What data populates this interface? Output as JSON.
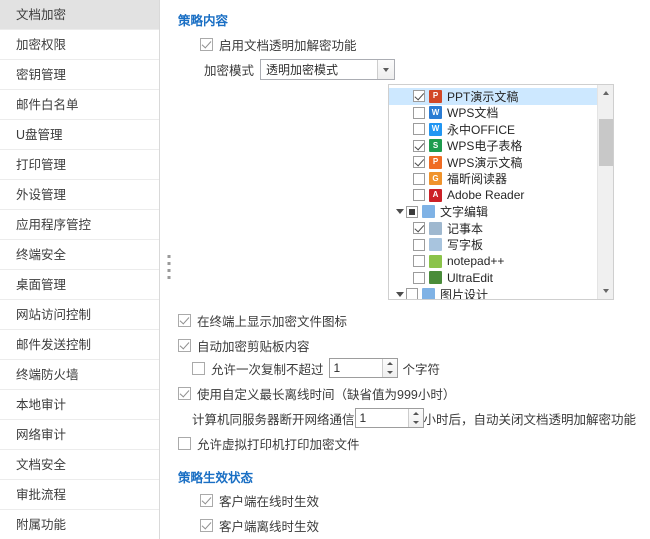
{
  "sidebar": {
    "items": [
      {
        "label": "文档加密",
        "active": true
      },
      {
        "label": "加密权限",
        "active": false
      },
      {
        "label": "密钥管理",
        "active": false
      },
      {
        "label": "邮件白名单",
        "active": false
      },
      {
        "label": "U盘管理",
        "active": false
      },
      {
        "label": "打印管理",
        "active": false
      },
      {
        "label": "外设管理",
        "active": false
      },
      {
        "label": "应用程序管控",
        "active": false
      },
      {
        "label": "终端安全",
        "active": false
      },
      {
        "label": "桌面管理",
        "active": false
      },
      {
        "label": "网站访问控制",
        "active": false
      },
      {
        "label": "邮件发送控制",
        "active": false
      },
      {
        "label": "终端防火墙",
        "active": false
      },
      {
        "label": "本地审计",
        "active": false
      },
      {
        "label": "网络审计",
        "active": false
      },
      {
        "label": "文档安全",
        "active": false
      },
      {
        "label": "审批流程",
        "active": false
      },
      {
        "label": "附属功能",
        "active": false
      }
    ]
  },
  "content": {
    "policy_section_title": "策略内容",
    "effect_section_title": "策略生效状态",
    "enable_transparent": {
      "label": "启用文档透明加解密功能",
      "checked": true
    },
    "mode": {
      "label": "加密模式",
      "value": "透明加密模式",
      "options": [
        "透明加密模式"
      ]
    },
    "tree": [
      {
        "label": "PPT演示文稿",
        "checked": true,
        "level": 1,
        "selected": true,
        "icon": "ppt-icon",
        "icon_text": "P",
        "icon_color": "#d24726"
      },
      {
        "label": "WPS文档",
        "checked": false,
        "level": 1,
        "selected": false,
        "icon": "wps-doc-icon",
        "icon_text": "W",
        "icon_color": "#2b7cd3"
      },
      {
        "label": "永中OFFICE",
        "checked": false,
        "level": 1,
        "selected": false,
        "icon": "yozo-office-icon",
        "icon_text": "W",
        "icon_color": "#2196f3"
      },
      {
        "label": "WPS电子表格",
        "checked": true,
        "level": 1,
        "selected": false,
        "icon": "wps-sheet-icon",
        "icon_text": "S",
        "icon_color": "#1e9c4e"
      },
      {
        "label": "WPS演示文稿",
        "checked": true,
        "level": 1,
        "selected": false,
        "icon": "wps-ppt-icon",
        "icon_text": "P",
        "icon_color": "#ef6c24"
      },
      {
        "label": "福昕阅读器",
        "checked": false,
        "level": 1,
        "selected": false,
        "icon": "foxit-reader-icon",
        "icon_text": "G",
        "icon_color": "#f0932b"
      },
      {
        "label": "Adobe Reader",
        "checked": false,
        "level": 1,
        "selected": false,
        "icon": "adobe-reader-icon",
        "icon_text": "A",
        "icon_color": "#cc2127"
      },
      {
        "label": "文字编辑",
        "checked": "partial",
        "level": 0,
        "selected": false,
        "expanded": true,
        "icon": "text-edit-group-icon",
        "icon_text": "",
        "icon_color": "#7fb2e5"
      },
      {
        "label": "记事本",
        "checked": true,
        "level": 1,
        "selected": false,
        "icon": "notepad-icon",
        "icon_text": "",
        "icon_color": "#9fb8cf"
      },
      {
        "label": "写字板",
        "checked": false,
        "level": 1,
        "selected": false,
        "icon": "wordpad-icon",
        "icon_text": "",
        "icon_color": "#a8c4de"
      },
      {
        "label": "notepad++",
        "checked": false,
        "level": 1,
        "selected": false,
        "icon": "notepadpp-icon",
        "icon_text": "",
        "icon_color": "#8bc34a"
      },
      {
        "label": "UltraEdit",
        "checked": false,
        "level": 1,
        "selected": false,
        "icon": "ultraedit-icon",
        "icon_text": "",
        "icon_color": "#4a8c3a"
      },
      {
        "label": "图片设计",
        "checked": false,
        "level": 0,
        "selected": false,
        "expanded": true,
        "icon": "image-design-group-icon",
        "icon_text": "",
        "icon_color": "#7fb2e5"
      }
    ],
    "show_icon_on_terminal": {
      "label": "在终端上显示加密文件图标",
      "checked": true
    },
    "auto_encrypt_clipboard": {
      "label": "自动加密剪贴板内容",
      "checked": true
    },
    "clipboard_limit": {
      "label": "允许一次复制不超过",
      "checked": false,
      "value": "1",
      "suffix": "个字符"
    },
    "custom_offline": {
      "label": "使用自定义最长离线时间（缺省值为999小时）",
      "checked": true
    },
    "offline_detail": {
      "prefix": "计算机同服务器断开网络通信",
      "value": "1",
      "suffix": "小时后，自动关闭文档透明加解密功能"
    },
    "virtual_print": {
      "label": "允许虚拟打印机打印加密文件",
      "checked": false
    },
    "online_effective": {
      "label": "客户端在线时生效",
      "checked": true
    },
    "offline_effective": {
      "label": "客户端离线时生效",
      "checked": true
    }
  },
  "colors": {
    "accent": "#1a6fc4",
    "sidebar_active": "#e2e2e2",
    "tree_selection": "#cde8ff"
  }
}
